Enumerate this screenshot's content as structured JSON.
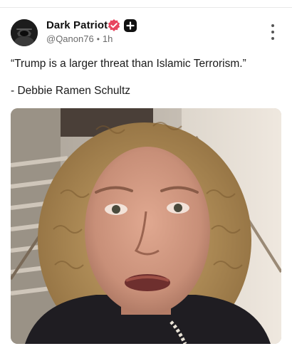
{
  "post": {
    "author": {
      "display_name": "Dark Patriot",
      "handle": "@Qanon76",
      "avatar_icon": "hooded-figure-avatar",
      "badges": [
        "verified-badge-icon",
        "plus-badge-icon"
      ]
    },
    "separator": "•",
    "time": "1h",
    "quote": "“Trump is a larger threat than Islamic Terrorism.”",
    "attribution": "- Debbie Ramen Schultz",
    "media": {
      "type": "video-still"
    }
  },
  "colors": {
    "verified_badge": "#e8455f",
    "plus_badge": "#111111",
    "meta_text": "#6b6b6b"
  }
}
